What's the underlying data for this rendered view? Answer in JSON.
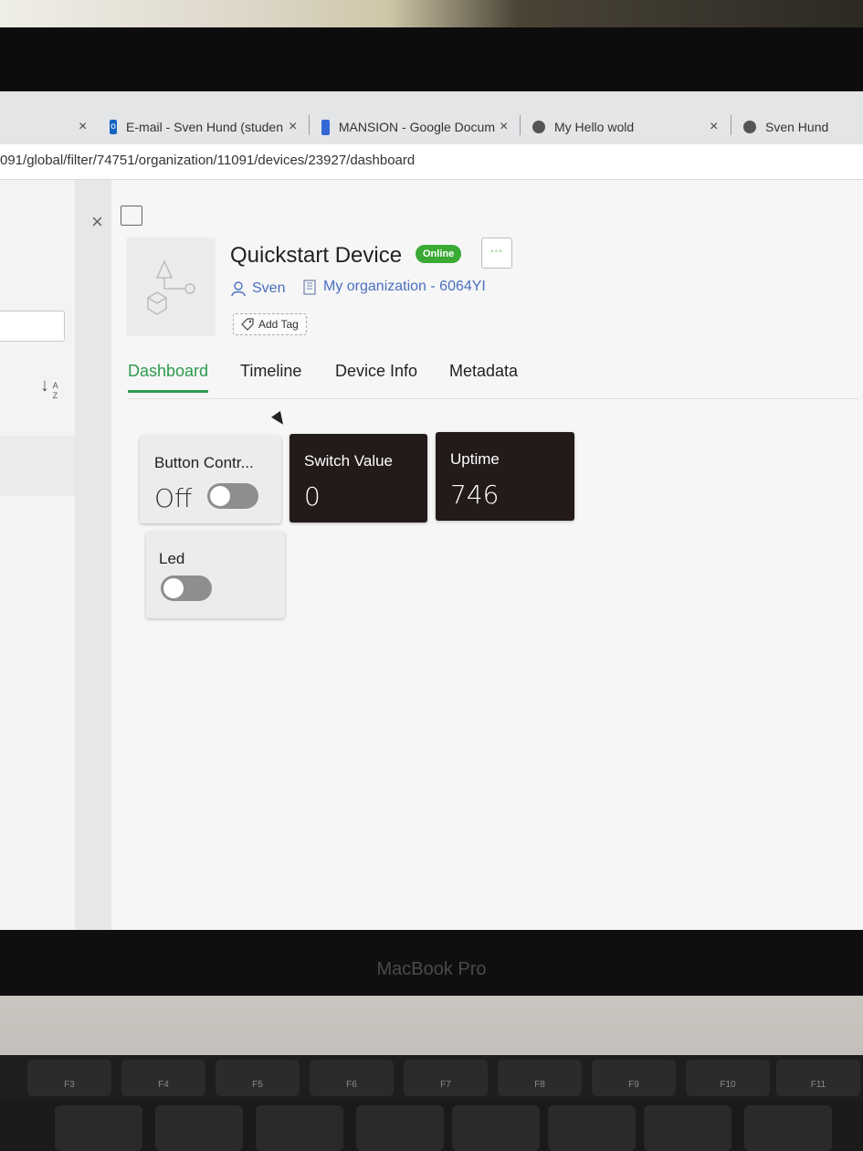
{
  "browser": {
    "tabs": [
      {
        "label": "E-mail - Sven Hund (studen",
        "icon": "outlook-icon"
      },
      {
        "label": "MANSION - Google Docum",
        "icon": "docs-icon"
      },
      {
        "label": "My Hello wold",
        "icon": "globe-icon"
      },
      {
        "label": "Sven Hund",
        "icon": "globe-icon"
      }
    ],
    "close_glyph": "×",
    "url": "091/global/filter/74751/organization/11091/devices/23927/dashboard"
  },
  "device": {
    "title": "Quickstart Device",
    "status": "Online",
    "more_glyph": "◦◦◦",
    "owner": "Sven",
    "organization": "My organization - 6064YI",
    "add_tag": "Add Tag"
  },
  "sidebar": {
    "sort_glyph": "↓",
    "sort_letters": "A Z"
  },
  "nav": {
    "tabs": [
      "Dashboard",
      "Timeline",
      "Device Info",
      "Metadata"
    ],
    "active": "Dashboard"
  },
  "widgets": {
    "button_control": {
      "title": "Button Contr...",
      "value": "Off",
      "toggle_on": false
    },
    "switch_value": {
      "title": "Switch Value",
      "value": "0"
    },
    "uptime": {
      "title": "Uptime",
      "value": "746"
    },
    "led": {
      "title": "Led",
      "toggle_on": false
    }
  },
  "laptop": {
    "brand": "MacBook Pro",
    "fkeys": [
      "F3",
      "F4",
      "F5",
      "F6",
      "F7",
      "F8",
      "F9",
      "F10",
      "F11"
    ]
  },
  "colors": {
    "accent_green": "#2e9a4f",
    "online_badge": "#3aaa35",
    "link_blue": "#4a6fbf",
    "dark_widget": "#231a1a"
  }
}
